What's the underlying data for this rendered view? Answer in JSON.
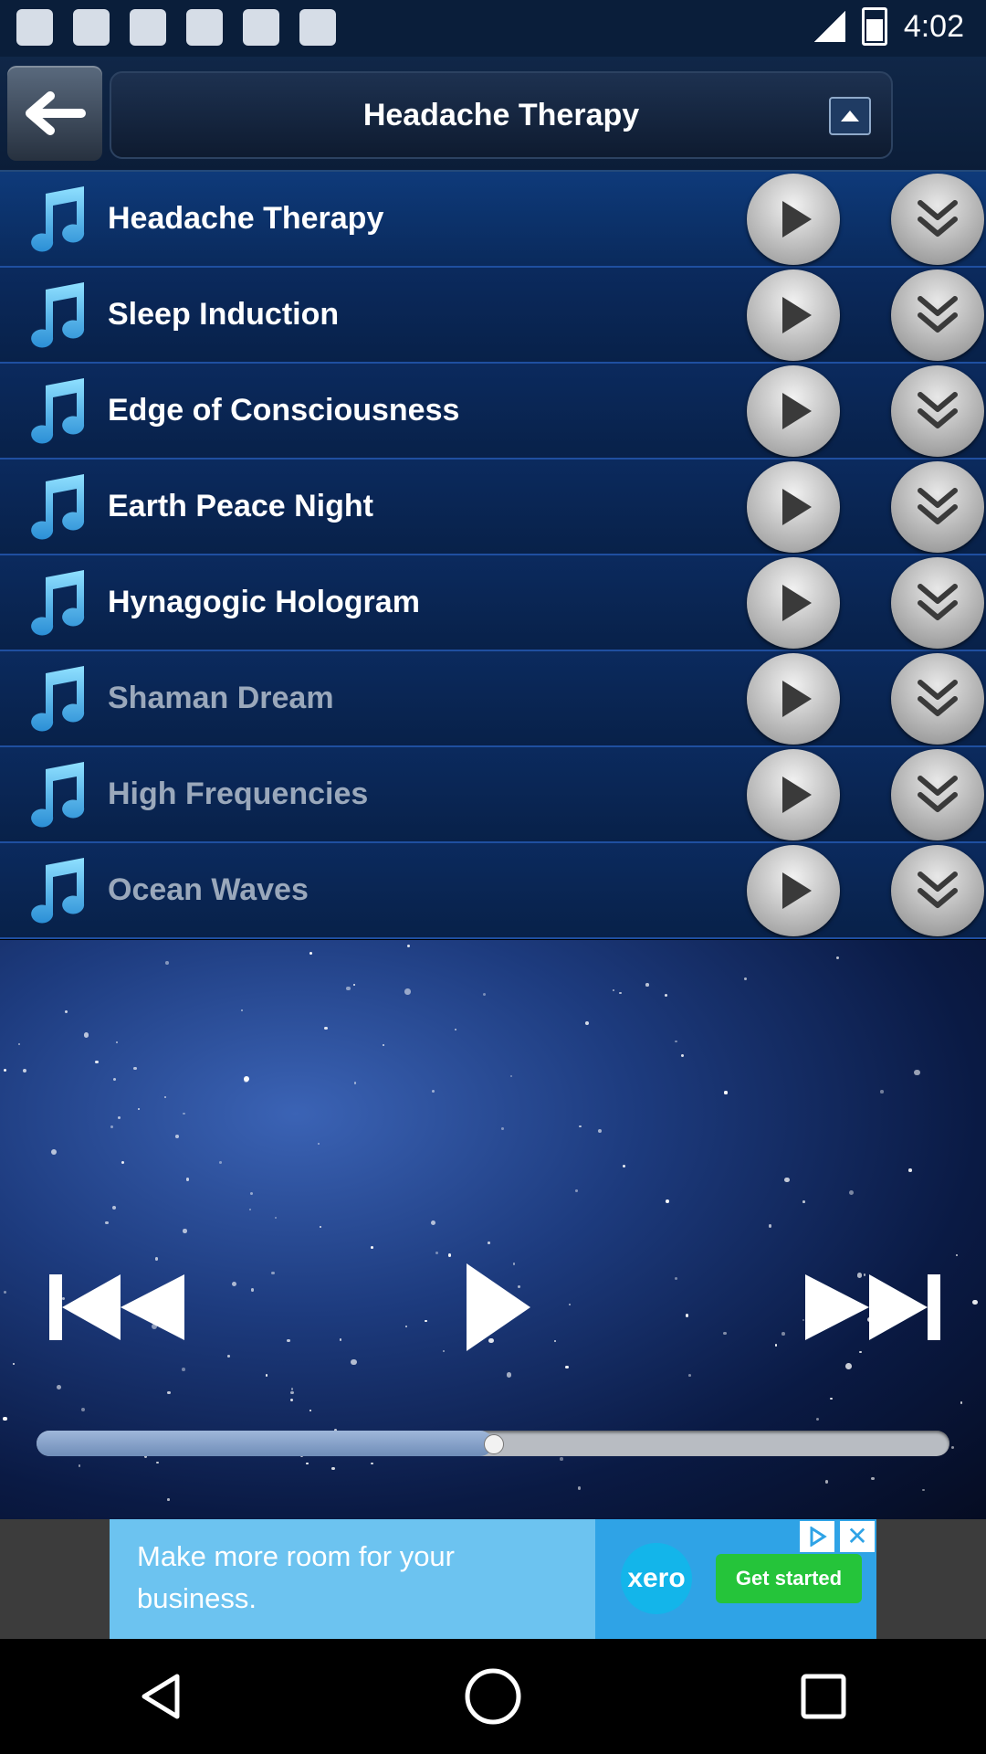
{
  "status_bar": {
    "time": "4:02",
    "left_icons": [
      "message-icon",
      "grid-icon",
      "square-icon",
      "wrench-icon",
      "info-icon",
      "satellite-icon"
    ]
  },
  "header": {
    "back_icon": "arrow-left-icon",
    "title": "Headache Therapy",
    "collapse_icon": "triangle-up-icon"
  },
  "tracks": [
    {
      "name": "Headache Therapy"
    },
    {
      "name": "Sleep Induction"
    },
    {
      "name": "Edge of Consciousness"
    },
    {
      "name": "Earth Peace Night"
    },
    {
      "name": "Hynagogic Hologram"
    },
    {
      "name": "Shaman Dream"
    },
    {
      "name": "High Frequencies"
    },
    {
      "name": "Ocean Waves"
    }
  ],
  "player": {
    "controls": [
      "skip-back-icon",
      "play-icon",
      "skip-forward-icon"
    ],
    "progress": 0.5
  },
  "ad": {
    "text": "Make more room for your business.",
    "brand": "xero",
    "cta": "Get started"
  },
  "nav": [
    "back-icon",
    "home-icon",
    "recents-icon"
  ]
}
